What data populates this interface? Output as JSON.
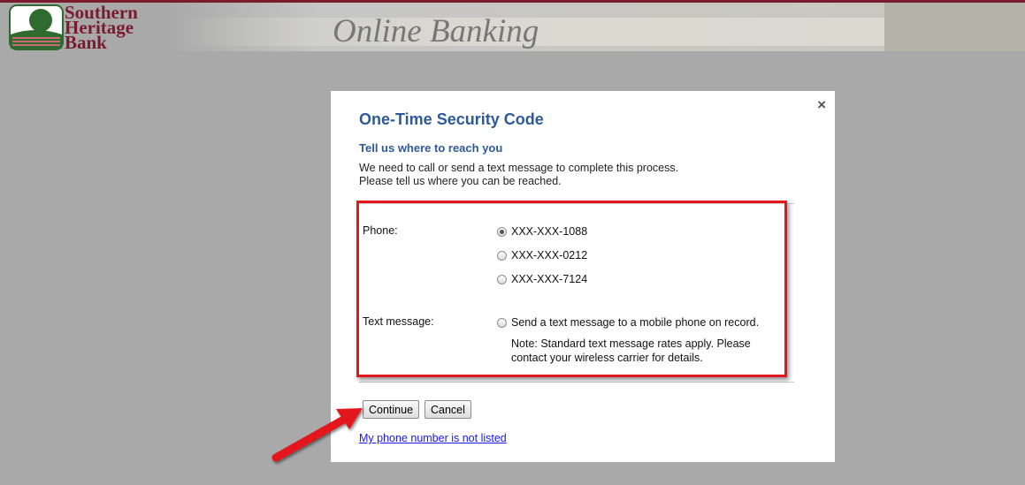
{
  "header": {
    "bank_name_lines": [
      "Southern",
      "Heritage",
      "Bank"
    ],
    "banner_title": "Online Banking"
  },
  "dialog": {
    "title": "One-Time Security Code",
    "subtitle": "Tell us where to reach you",
    "intro_lines": [
      "We need to call or send a text message to complete this process.",
      "Please tell us where you can be reached."
    ],
    "phone_label": "Phone:",
    "phone_options": [
      {
        "label": "XXX-XXX-1088",
        "checked": true
      },
      {
        "label": "XXX-XXX-0212",
        "checked": false
      },
      {
        "label": "XXX-XXX-7124",
        "checked": false
      }
    ],
    "text_label": "Text message:",
    "text_option": {
      "label": "Send a text message to a mobile phone on record.",
      "checked": false
    },
    "note_lines": [
      "Note: Standard text message rates apply. Please",
      "contact your wireless carrier for details."
    ],
    "continue_label": "Continue",
    "cancel_label": "Cancel",
    "not_listed_link": "My phone number is not listed",
    "close_glyph": "×"
  },
  "colors": {
    "brand": "#7a1b2e",
    "heading": "#2d5a99",
    "highlight": "#e3181e",
    "link": "#1a1ae6"
  }
}
